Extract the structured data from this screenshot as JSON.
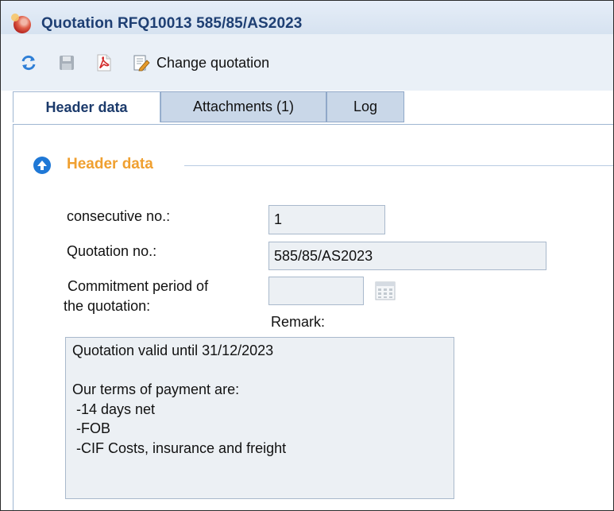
{
  "window": {
    "title": "Quotation RFQ10013 585/85/AS2023",
    "app_icon": "app-logo-icon"
  },
  "toolbar": {
    "refresh_icon": "refresh-icon",
    "save_icon": "save-icon",
    "pdf_icon": "pdf-icon",
    "change_icon": "edit-document-icon",
    "change_label": "Change quotation"
  },
  "tabs": [
    {
      "label": "Header data",
      "active": true
    },
    {
      "label": "Attachments (1)",
      "active": false
    },
    {
      "label": "Log",
      "active": false
    }
  ],
  "section": {
    "title": "Header data",
    "icon": "collapse-up-icon"
  },
  "form": {
    "consecutive_label": "consecutive no.:",
    "consecutive_value": "1",
    "quotation_no_label": "Quotation no.:",
    "quotation_no_value": "585/85/AS2023",
    "commitment_label_line1": "Commitment period of",
    "commitment_label_line2": "the quotation:",
    "commitment_value": "",
    "remark_label": "Remark:",
    "remark_text": "Quotation valid until 31/12/2023\n\nOur terms of payment are:\n -14 days net\n -FOB\n -CIF Costs, insurance and freight"
  },
  "colors": {
    "title_text": "#1e3f73",
    "section_title": "#f0a030",
    "tab_inactive_bg": "#c9d7e8",
    "field_bg": "#ecf0f4"
  }
}
